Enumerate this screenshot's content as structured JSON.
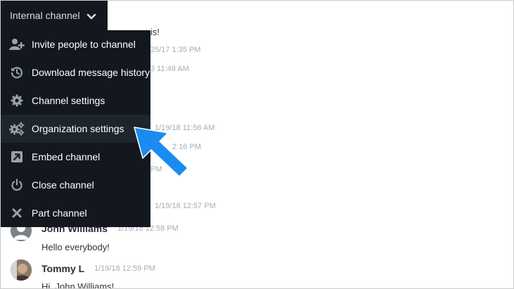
{
  "header": {
    "title": "Internal channel",
    "chevron_icon": "chevron-down-icon"
  },
  "menu": {
    "items": [
      {
        "label": "Invite people to channel",
        "icon": "add-user-icon"
      },
      {
        "label": "Download message history",
        "icon": "history-icon"
      },
      {
        "label": "Channel settings",
        "icon": "gear-icon"
      },
      {
        "label": "Organization settings",
        "icon": "gears-icon"
      },
      {
        "label": "Embed channel",
        "icon": "embed-icon"
      },
      {
        "label": "Close channel",
        "icon": "power-icon"
      },
      {
        "label": "Part channel",
        "icon": "close-icon"
      }
    ],
    "highlighted_index": 3
  },
  "fragments": {
    "f1": "is!",
    "f2": "25/17 1:35 PM",
    "f3": "3 11:48 AM",
    "f4": "1/19/18 11:56 AM",
    "f5": "2:16 PM",
    "f6": "PM",
    "f7": "1/19/18 12:57 PM"
  },
  "messages": [
    {
      "name": "John Williams",
      "time": "1/19/18 12:58 PM",
      "text": "Hello everybody!"
    },
    {
      "name": "Tommy L",
      "time": "1/19/18 12:59 PM",
      "text": "Hi, John Williams!"
    }
  ],
  "colors": {
    "menu_bg": "#13181e",
    "menu_hover": "#1f252c",
    "arrow": "#1a8cf0"
  }
}
